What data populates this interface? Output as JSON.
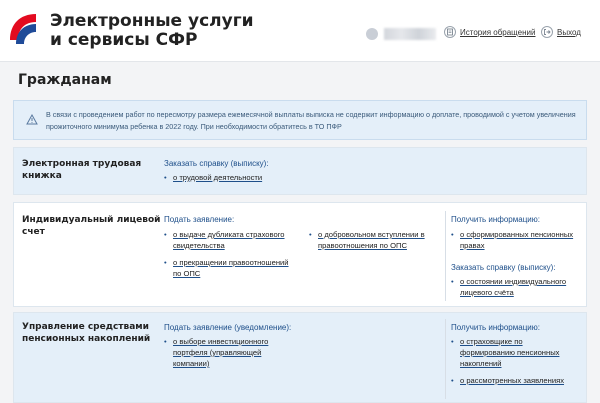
{
  "header": {
    "brand_line1": "Электронные услуги",
    "brand_line2": "и сервисы СФР",
    "history_label": "История обращений",
    "exit_label": "Выход"
  },
  "page": {
    "title": "Гражданам"
  },
  "alert": {
    "text": "В связи с проведением работ по пересмотру размера ежемесячной выплаты выписка не содержит информацию о доплате, проводимой с учетом увеличения прожиточного минимума ребенка в 2022 году. При необходимости обратитесь в ТО ПФР"
  },
  "sections": [
    {
      "title": "Электронная трудовая книжка",
      "col1_heading": "Заказать справку (выписку):",
      "col1_links": [
        "о трудовой деятельности"
      ]
    },
    {
      "title": "Индивидуальный лицевой счет",
      "col1_heading": "Подать заявление:",
      "col1_links": [
        "о выдаче дубликата страхового свидетельства",
        "о прекращении правоотношений по ОПС"
      ],
      "col2_links": [
        "о добровольном вступлении в правоотношения по ОПС"
      ],
      "col3_heading_a": "Получить информацию:",
      "col3_links_a": [
        "о сформированных пенсионных правах"
      ],
      "col3_heading_b": "Заказать справку (выписку):",
      "col3_links_b": [
        "о состоянии индивидуального лицевого счёта"
      ]
    },
    {
      "title": "Управление средствами пенсионных накоплений",
      "col1_heading": "Подать заявление (уведомление):",
      "col1_links": [
        "о выборе инвестиционного портфеля (управляющей компании)"
      ],
      "col3_heading_a": "Получить информацию:",
      "col3_links_a": [
        "о страховщике по формированию пенсионных накоплений",
        "о рассмотренных заявлениях"
      ]
    }
  ],
  "colors": {
    "accent": "#1e4f8a",
    "logo_red": "#e30b20",
    "logo_blue": "#1f4b99",
    "alert_bg": "#e4eff9"
  },
  "icons": {
    "logo": "sfr-logo",
    "avatar": "user-avatar-icon",
    "history": "history-icon",
    "exit": "exit-icon",
    "alert": "warning-icon"
  }
}
